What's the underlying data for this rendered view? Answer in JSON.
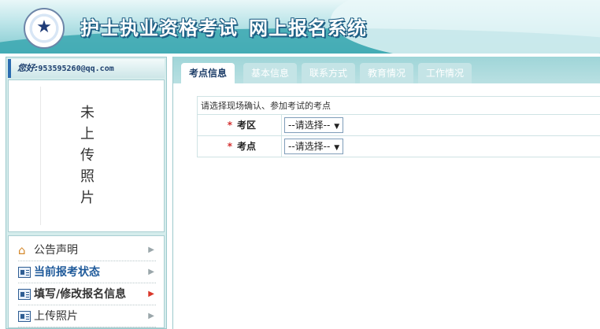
{
  "header": {
    "title_part1": "护士执业资格考试",
    "title_part2": "网上报名系统",
    "logo_icon": "emblem-icon"
  },
  "user": {
    "greeting_label": "您好:",
    "email": "953595260@qq.com"
  },
  "photo": {
    "placeholder_text": "未上传照片"
  },
  "menu": {
    "items": [
      {
        "label": "公告声明",
        "icon": "house-icon",
        "arrow_color": "#9aa6aa"
      },
      {
        "label": "当前报考状态",
        "icon": "card-icon",
        "arrow_color": "#9aa6aa"
      },
      {
        "label": "填写/修改报名信息",
        "icon": "card-icon",
        "arrow_color": "#d9372a"
      },
      {
        "label": "上传照片",
        "icon": "card-icon",
        "arrow_color": "#9aa6aa"
      }
    ]
  },
  "tabs": [
    {
      "label": "考点信息",
      "active": true
    },
    {
      "label": "基本信息",
      "active": false
    },
    {
      "label": "联系方式",
      "active": false
    },
    {
      "label": "教育情况",
      "active": false
    },
    {
      "label": "工作情况",
      "active": false
    }
  ],
  "form": {
    "instruction": "请选择现场确认、参加考试的考点",
    "required_mark": "*",
    "fields": [
      {
        "label": "考区",
        "selected": "--请选择--"
      },
      {
        "label": "考点",
        "selected": "--请选择--"
      }
    ]
  },
  "colors": {
    "accent": "#1d5e84",
    "required": "#d32f2f"
  }
}
